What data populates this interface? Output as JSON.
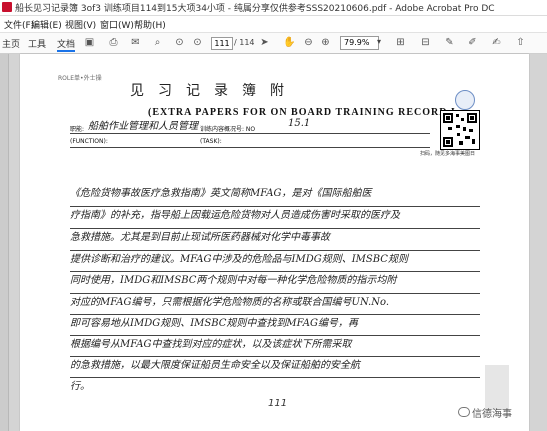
{
  "window": {
    "title": "船长见习记录簿 3of3 训练项目114到15大项34小项 - 纯属分享仅供参考SSS20210606.pdf - Adobe Acrobat Pro DC"
  },
  "menu": {
    "items": [
      "文件(F)",
      "编辑(E)",
      "视图(V)",
      "窗口(W)",
      "帮助(H)"
    ]
  },
  "toolbar": {
    "tabs": [
      "主页",
      "工具",
      "文档"
    ],
    "page_current": "111",
    "page_total": "/ 114",
    "zoom": "79.9%"
  },
  "document": {
    "running_head": "ROLE单•外士操",
    "title": "见习记录簿附",
    "subtitle": "(EXTRA PAPERS FOR ON BOARD TRAINING RECORD I",
    "qr_label": "扫码，随见多海事美图日",
    "fields": {
      "position_label": "职能:",
      "position_value": "船舶作业管理和人员管理",
      "item_label": "训练内容概况号: NO",
      "item_value": "15.1",
      "item2_label": "训练内容概况号: NO",
      "function_label": "(FUNCTION):",
      "task_label": "(TASK):"
    },
    "lines": [
      "《危险货物事故医疗急救指南》英文简称MFAG，是对《国际船舶医",
      "疗指南》的补充，指导船上因载运危险货物对人员造成伤害时采取的医疗及",
      "急救措施。尤其是到目前止现试所医药器械对化学中毒事故",
      "提供诊断和治疗的建议。MFAG中涉及的危险品与IMDG规则、IMSBC规则",
      "同时使用，IMDG和IMSBC两个规则中对每一种化学危险物质的指示均附",
      "对应的MFAG编号，只需根据化学危险物质的名称或联合国编号UN.No.",
      "即可容易地从IMDG规则、IMSBC规则中查找到MFAG编号，再",
      "根据编号从MFAG中查找到对应的症状，以及该症状下所需采取",
      "的急救措施，以最大限度保证船员生命安全以及保证船舶的安全航",
      "行。"
    ],
    "page_number": "111"
  },
  "watermark": {
    "text": "信德海事"
  }
}
